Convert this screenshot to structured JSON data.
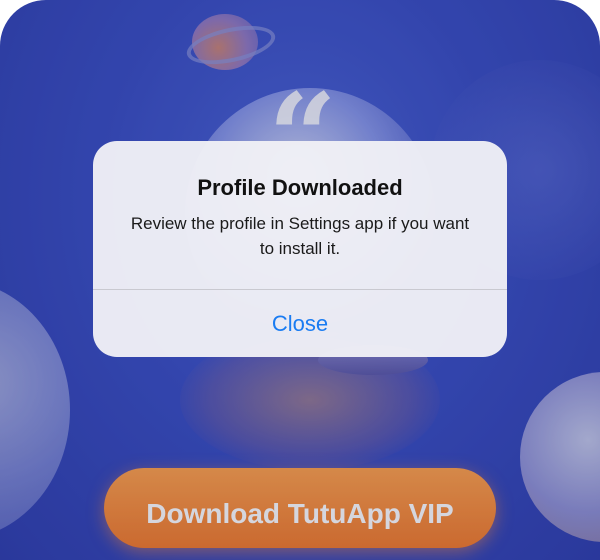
{
  "background": {
    "decoration_icons": [
      "planet-icon",
      "quote-mark-icon"
    ],
    "quote_glyph": "“",
    "download_button_label": "Download TutuApp VIP",
    "primary_color": "#3a4fc4",
    "button_color": "#f37b2b"
  },
  "alert": {
    "title": "Profile Downloaded",
    "message": "Review the profile in Settings app if you want to install it.",
    "close_label": "Close",
    "action_color": "#1a7cf2"
  }
}
